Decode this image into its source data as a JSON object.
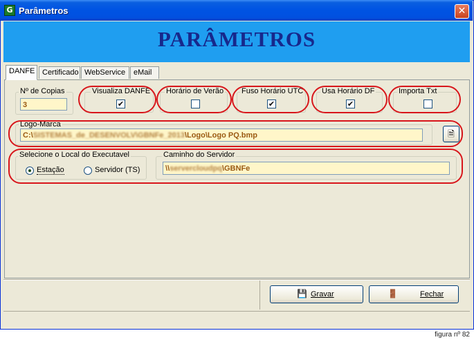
{
  "window": {
    "title": "Parâmetros",
    "app_icon_glyph": "G",
    "close_glyph": "✕"
  },
  "banner": {
    "title": "PARÂMETROS"
  },
  "tabs": [
    {
      "label": "DANFE",
      "active": true
    },
    {
      "label": "Certificado"
    },
    {
      "label": "WebService"
    },
    {
      "label": "eMail"
    }
  ],
  "copias": {
    "label": "Nº de Copias",
    "value": "3"
  },
  "options": {
    "visualiza_danfe": {
      "label": "Visualiza DANFE",
      "checked": true,
      "mark": "✔"
    },
    "horario_verao": {
      "label": "Horário de Verão",
      "checked": false
    },
    "fuso_utc": {
      "label": "Fuso Horário UTC",
      "checked": true,
      "mark": "✔"
    },
    "horario_df": {
      "label": "Usa Horário DF",
      "checked": true,
      "mark": "✔"
    },
    "importa_txt": {
      "label": "Importa Txt",
      "checked": false
    }
  },
  "logo": {
    "label": "Logo-Marca",
    "path_prefix": "C:\\",
    "path_blurred": "SISTEMAS_de_DESENVOLV\\GBNFe_2013",
    "path_suffix": "\\Logo\\Logo PQ.bmp",
    "browse_icon": "🗎"
  },
  "local": {
    "label": "Selecione o Local do Executavel",
    "estacao": "Estação",
    "servidor": "Servidor (TS)",
    "selected": "estacao"
  },
  "servidor": {
    "label": "Caminho do Servidor",
    "path_prefix": "\\\\",
    "path_blurred": "servercloudpq",
    "path_suffix": "\\GBNFe"
  },
  "buttons": {
    "gravar": {
      "label": "Gravar",
      "icon": "💾"
    },
    "fechar": {
      "label": "Fechar",
      "icon": "🚪"
    }
  },
  "caption": "figura nº 82",
  "colors": {
    "banner": "#1f9ef0",
    "banner_text": "#17288c",
    "highlight": "#d8161b",
    "field_bg": "#fff6c9"
  }
}
